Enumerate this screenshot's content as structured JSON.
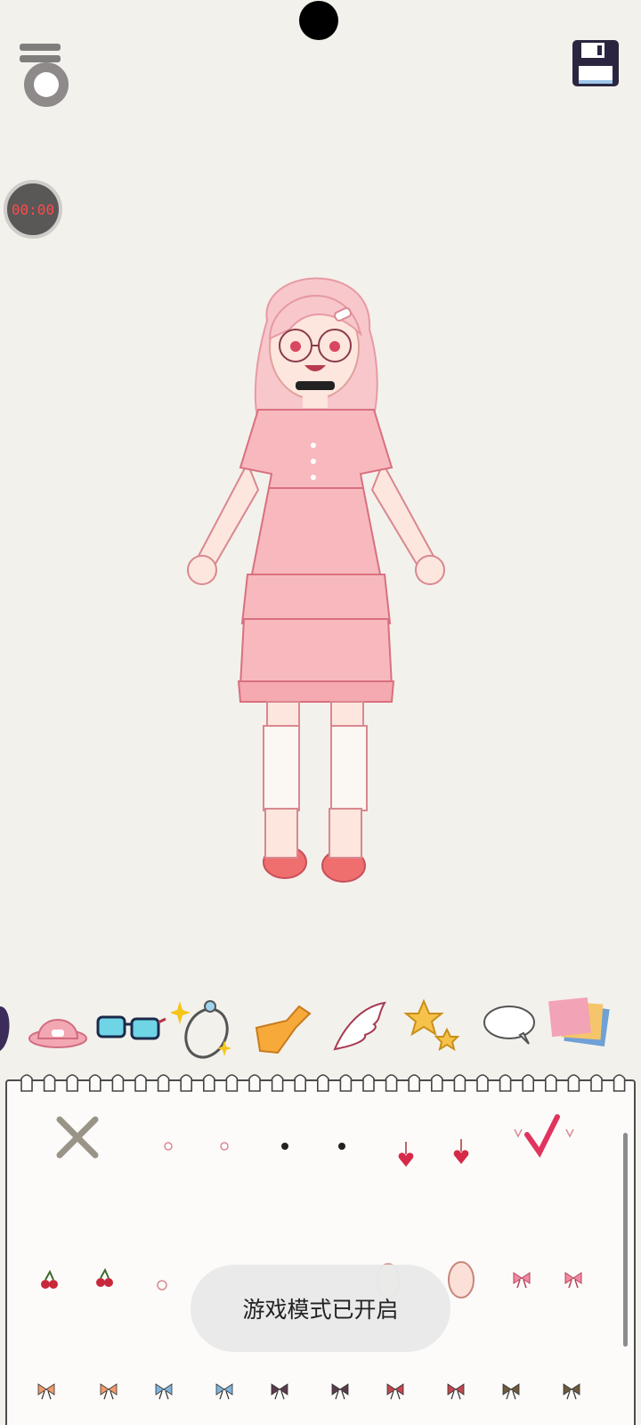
{
  "toolbar": {
    "menu_icon": "hamburger-menu-icon",
    "save_icon": "floppy-disk-icon",
    "record_label": "00:00"
  },
  "categories": [
    {
      "name": "hair-icon"
    },
    {
      "name": "hat-icon"
    },
    {
      "name": "glasses-icon"
    },
    {
      "name": "ring-icon"
    },
    {
      "name": "scarf-icon"
    },
    {
      "name": "wings-icon"
    },
    {
      "name": "stars-icon"
    },
    {
      "name": "speech-bubble-icon"
    },
    {
      "name": "background-cards-icon"
    }
  ],
  "items_row1": [
    "none-x",
    "pink-stud-small",
    "pink-stud",
    "black-stud-small",
    "black-stud",
    "heart-drop",
    "heart-drop-2",
    "selected-heart-outline"
  ],
  "items_row2": [
    "cherry",
    "cherry-2",
    "small-ring",
    "hidden-1",
    "hidden-2",
    "egg-1",
    "egg-2",
    "pink-bow",
    "pink-bow-2"
  ],
  "items_row3": [
    "orange-bow",
    "orange-bow-2",
    "blue-bow",
    "blue-bow-2",
    "dark-bow",
    "dark-bow-2",
    "red-bow",
    "red-bow-2",
    "brown-bow",
    "brown-bow-2"
  ],
  "toast": {
    "text": "游戏模式已开启"
  },
  "colors": {
    "background": "#f3f1ec",
    "accent_pink": "#e34a6f",
    "dress": "#f7b9be"
  }
}
